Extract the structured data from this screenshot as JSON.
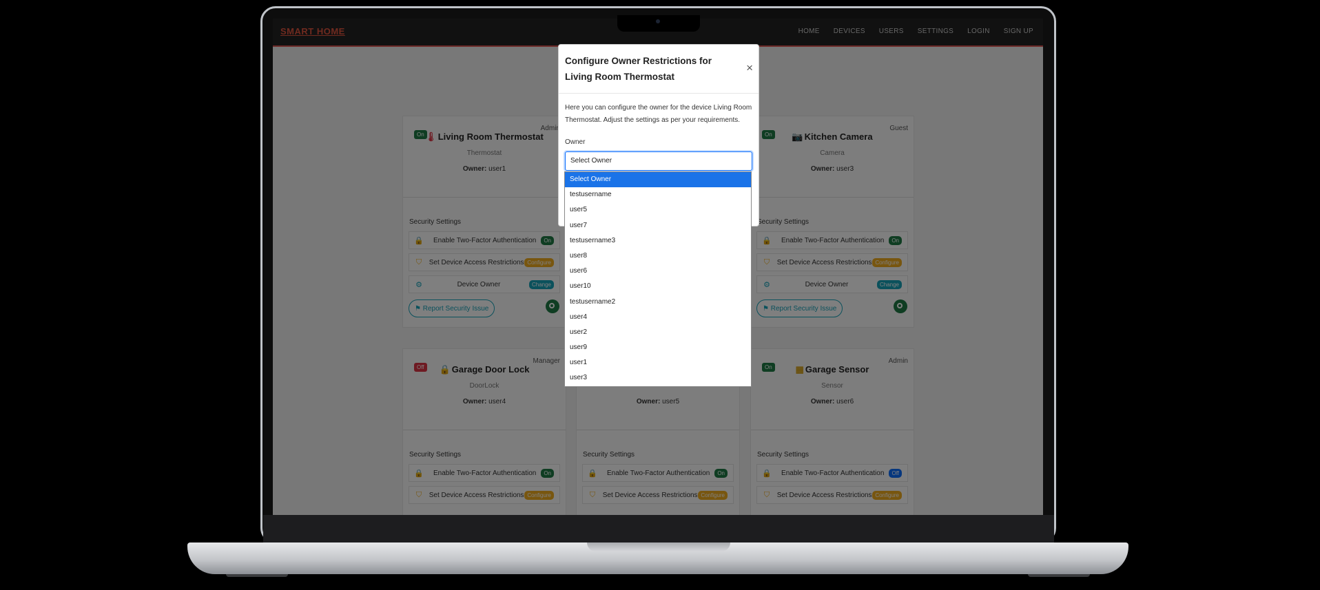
{
  "brand": "SMART HOME",
  "nav": [
    "HOME",
    "DEVICES",
    "USERS",
    "SETTINGS",
    "LOGIN",
    "SIGN UP"
  ],
  "cards": [
    {
      "status": "On",
      "status_kind": "on",
      "role": "Admin",
      "icon": "thermometer-icon",
      "icon_glyph": "🌡",
      "name": "Living Room Thermostat",
      "type": "Thermostat",
      "owner_label": "Owner:",
      "owner": "user1"
    },
    {
      "status": "On",
      "status_kind": "on",
      "role": "Guest",
      "icon": "camera-icon",
      "icon_glyph": "📷",
      "name": "Kitchen Camera",
      "type": "Camera",
      "owner_label": "Owner:",
      "owner": "user3"
    },
    {
      "status": "Off",
      "status_kind": "off",
      "role": "Manager",
      "icon": "lock-icon",
      "icon_glyph": "🔒",
      "name": "Garage Door Lock",
      "type": "DoorLock",
      "owner_label": "Owner:",
      "owner": "user4"
    },
    {
      "status": "",
      "status_kind": "on",
      "role": "",
      "icon": "",
      "icon_glyph": "",
      "name": "",
      "type": "",
      "owner_label": "Owner:",
      "owner": "user5"
    },
    {
      "status": "On",
      "status_kind": "on",
      "role": "Admin",
      "icon": "sensor-icon",
      "icon_glyph": "▦",
      "name": "Garage Sensor",
      "type": "Sensor",
      "owner_label": "Owner:",
      "owner": "user6"
    }
  ],
  "security": {
    "title": "Security Settings",
    "two_factor": "Enable Two-Factor Authentication",
    "access": "Set Device Access Restrictions",
    "owner": "Device Owner",
    "on": "On",
    "off": "Off",
    "configure": "Configure",
    "change": "Change",
    "report": "Report Security Issue"
  },
  "modal": {
    "title": "Configure Owner Restrictions for Living Room Thermostat",
    "close": "×",
    "description": "Here you can configure the owner for the device Living Room Thermostat. Adjust the settings as per your requirements.",
    "owner_label": "Owner",
    "selected": "Select Owner",
    "options": [
      "Select Owner",
      "testusername",
      "user5",
      "user7",
      "testusername3",
      "user8",
      "user6",
      "user10",
      "testusername2",
      "user4",
      "user2",
      "user9",
      "user1",
      "user3"
    ]
  },
  "colors": {
    "brand": "#e0553f",
    "on": "#1e7a45",
    "off": "#dc3545",
    "configure": "#f0ad1f",
    "change": "#17a2b8",
    "selected_option": "#1a73e8"
  }
}
